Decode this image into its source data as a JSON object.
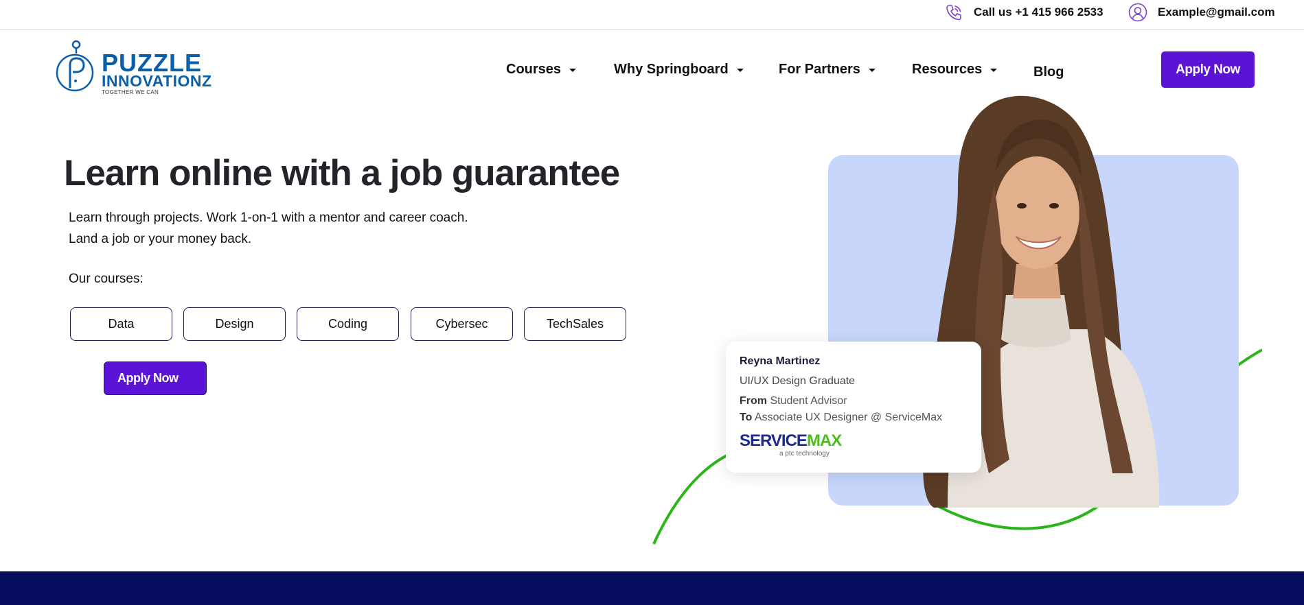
{
  "topbar": {
    "phone_text": "Call us +1 415 966 2533",
    "phone_icon": "phone-icon",
    "email_text": "Example@gmail.com",
    "email_icon": "user-circle-icon",
    "icon_color": "#7b3fd1"
  },
  "logo": {
    "line1": "PUZZLE",
    "line2": "INNOVATIONZ",
    "tagline": "TOGETHER WE CAN",
    "color": "#0b5ea8"
  },
  "nav": {
    "items": [
      {
        "label": "Courses",
        "has_dropdown": true
      },
      {
        "label": "Why Springboard",
        "has_dropdown": true
      },
      {
        "label": "For Partners",
        "has_dropdown": true
      },
      {
        "label": "Resources",
        "has_dropdown": true
      },
      {
        "label": "Blog",
        "has_dropdown": false
      }
    ],
    "cta_label": "Apply Now"
  },
  "hero": {
    "title": "Learn online with a job guarantee",
    "subtitle_line1": "Learn through projects. Work 1-on-1 with a mentor and career coach.",
    "subtitle_line2": "Land a job or your money back.",
    "courses_label": "Our courses:",
    "courses": [
      "Data",
      "Design",
      "Coding",
      "Cybersec",
      "TechSales"
    ],
    "cta_label": "Apply Now"
  },
  "testimonial": {
    "name": "Reyna Martinez",
    "role": "UI/UX Design Graduate",
    "from_label": "From",
    "from_value": "Student Advisor",
    "to_label": "To",
    "to_value": "Associate UX Designer @ ServiceMax",
    "company_logo_part1": "SERVICE",
    "company_logo_part2": "MAX",
    "company_logo_sub": "a ptc technology"
  },
  "colors": {
    "accent": "#5b13d6",
    "card_blue": "#c7d6fa",
    "curve_green": "#2bb51a",
    "footer_navy": "#080c5e"
  }
}
